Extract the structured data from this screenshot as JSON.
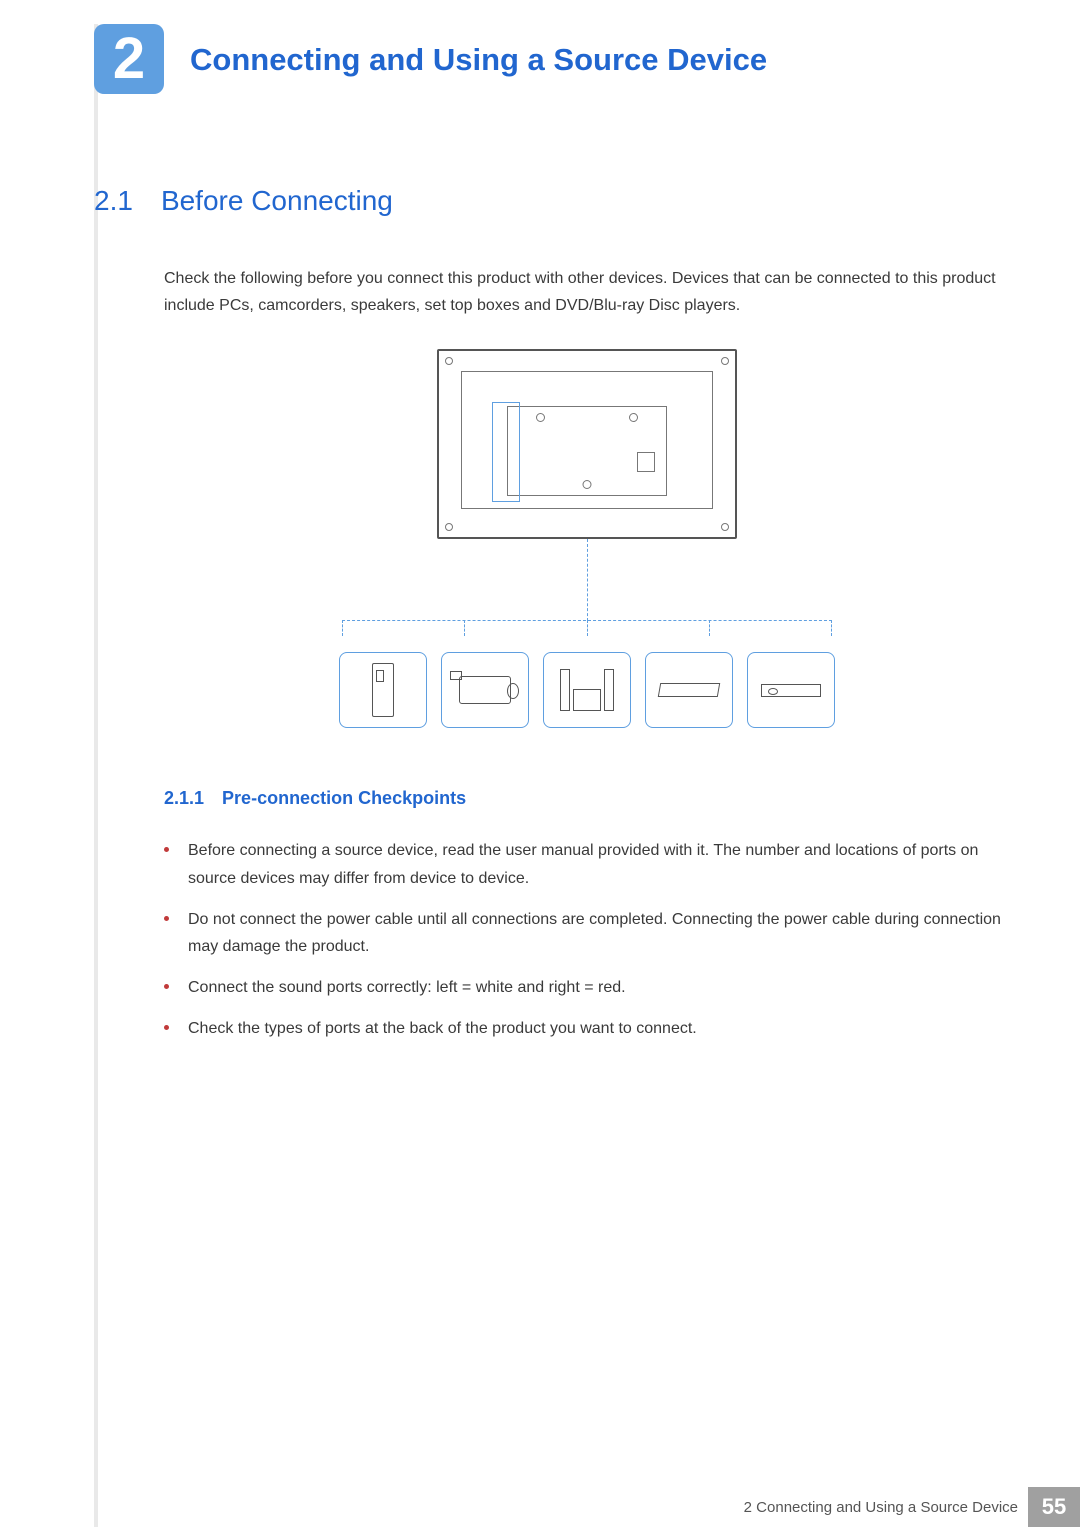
{
  "chapter": {
    "number": "2",
    "title": "Connecting and Using a Source Device"
  },
  "section": {
    "number": "2.1",
    "title": "Before Connecting"
  },
  "intro": "Check the following before you connect this product with other devices. Devices that can be connected to this product include PCs, camcorders, speakers, set top boxes and DVD/Blu-ray Disc players.",
  "subsection": {
    "number": "2.1.1",
    "title": "Pre-connection Checkpoints"
  },
  "checkpoints": [
    "Before connecting a source device, read the user manual provided with it. The number and locations of ports on source devices may differ from device to device.",
    "Do not connect the power cable until all connections are completed. Connecting the power cable during connection may damage the product.",
    "Connect the sound ports correctly: left = white and right = red.",
    "Check the types of ports at the back of the product you want to connect."
  ],
  "footer": {
    "chapter_ref": "2",
    "title": "Connecting and Using a Source Device",
    "page": "55"
  },
  "devices": [
    "pc",
    "camcorder",
    "speakers",
    "set-top-box",
    "dvd-player"
  ]
}
